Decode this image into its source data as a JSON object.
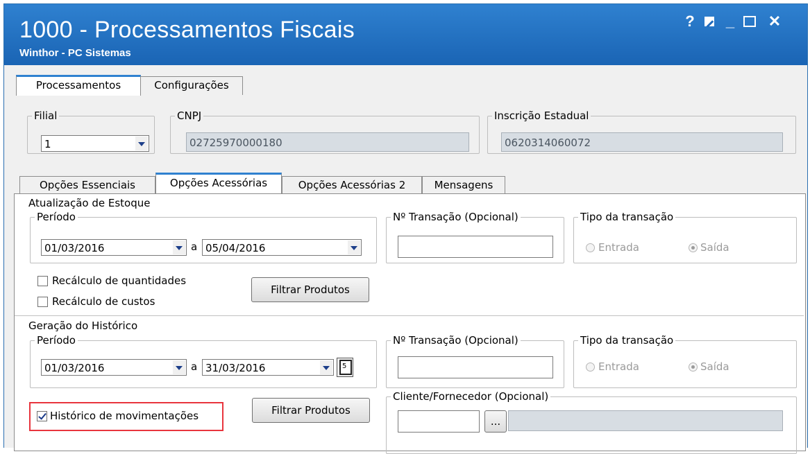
{
  "window": {
    "title": "1000 - Processamentos Fiscais",
    "subtitle": "Winthor - PC Sistemas",
    "controls": {
      "help": "?",
      "minimize": "_",
      "close": "✕"
    }
  },
  "main_tabs": [
    "Processamentos",
    "Configurações"
  ],
  "filial": {
    "label": "Filial",
    "value": "1"
  },
  "cnpj": {
    "label": "CNPJ",
    "value": "02725970000180"
  },
  "ie": {
    "label": "Inscrição Estadual",
    "value": "0620314060072"
  },
  "sub_tabs": [
    "Opções Essenciais",
    "Opções Acessórias",
    "Opções Acessórias 2",
    "Mensagens"
  ],
  "estoque": {
    "section_label": "Atualização de Estoque",
    "periodo_label": "Período",
    "date_from": "01/03/2016",
    "date_sep": "a",
    "date_to": "05/04/2016",
    "transacao_label": "Nº Transação (Opcional)",
    "transacao_value": "",
    "tipo_label": "Tipo da transação",
    "tipo_entrada": "Entrada",
    "tipo_saida": "Saída",
    "recalc_qtd": "Recálculo de quantidades",
    "recalc_custos": "Recálculo de custos",
    "filtrar": "Filtrar Produtos"
  },
  "historico": {
    "section_label": "Geração do Histórico",
    "periodo_label": "Período",
    "date_from": "01/03/2016",
    "date_sep": "a",
    "date_to": "31/03/2016",
    "transacao_label": "Nº Transação (Opcional)",
    "transacao_value": "",
    "tipo_label": "Tipo da transação",
    "tipo_entrada": "Entrada",
    "tipo_saida": "Saída",
    "historico_mov": "Histórico de movimentações",
    "filtrar": "Filtrar Produtos",
    "cliente_label": "Cliente/Fornecedor (Opcional)",
    "cliente_code": "",
    "browse": "...",
    "cliente_name": ""
  }
}
